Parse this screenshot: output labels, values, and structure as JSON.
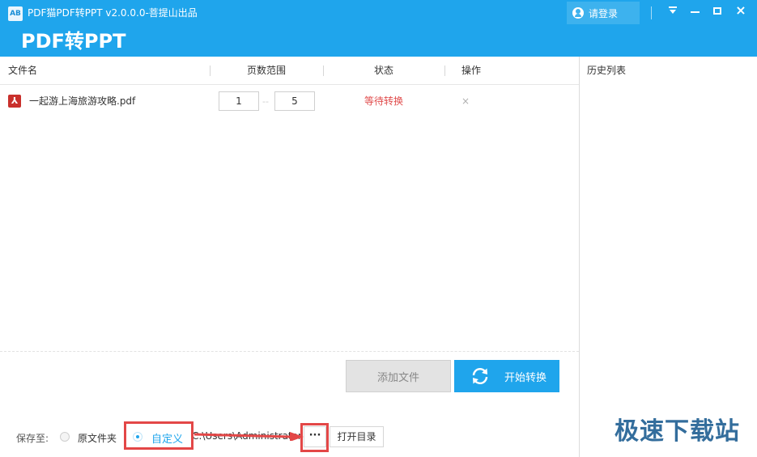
{
  "window": {
    "title": "PDF猫PDF转PPT v2.0.0.0-菩提山出品",
    "app_name": "PDF转PPT",
    "logo_text": "AB",
    "login_label": "请登录",
    "close_glyph": "×"
  },
  "table": {
    "columns": [
      "文件名",
      "页数范围",
      "状态",
      "操作"
    ],
    "rows": [
      {
        "file_icon": "pdf-icon",
        "icon_glyph": "⅄",
        "file_name": "一起游上海旅游攻略.pdf",
        "page_from": "1",
        "page_dash": "--",
        "page_to": "5",
        "status": "等待转换",
        "action_glyph": "×"
      }
    ]
  },
  "buttons": {
    "add_file": "添加文件",
    "start_convert": "开始转换",
    "browse": "···",
    "open_dir": "打开目录"
  },
  "save": {
    "label": "保存至:",
    "option_original": "原文件夹",
    "option_custom": "自定义",
    "selected": "自定义",
    "path": "C:\\Users\\Administrator"
  },
  "history": {
    "title": "历史列表"
  },
  "watermark": "极速下载站",
  "colors": {
    "accent": "#1fa5ec",
    "status_waiting": "#e04b4b",
    "annotation": "#e34747"
  }
}
